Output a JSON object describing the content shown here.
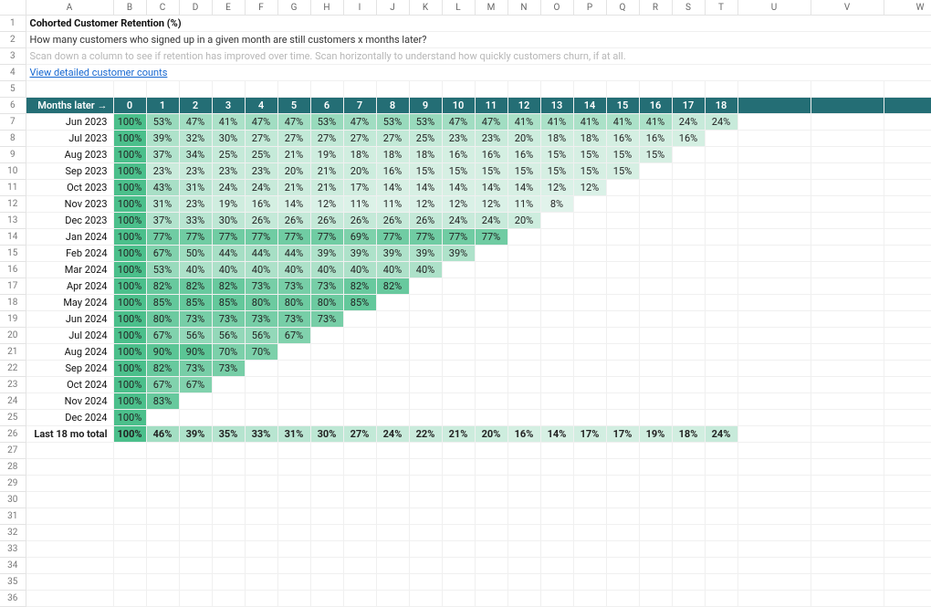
{
  "columns": [
    "A",
    "B",
    "C",
    "D",
    "E",
    "F",
    "G",
    "H",
    "I",
    "J",
    "K",
    "L",
    "M",
    "N",
    "O",
    "P",
    "Q",
    "R",
    "S",
    "T",
    "U",
    "V",
    "W"
  ],
  "row_count": 36,
  "title": "Cohorted Customer Retention (%)",
  "description": "How many customers who signed up in a given month are still customers x months later?",
  "hint": "Scan down a column to see if retention has improved over time. Scan horizontally to understand how quickly customers churn, if at all.",
  "link_text": "View detailed customer counts",
  "band_label": "Months later →",
  "months_later": [
    "0",
    "1",
    "2",
    "3",
    "4",
    "5",
    "6",
    "7",
    "8",
    "9",
    "10",
    "11",
    "12",
    "13",
    "14",
    "15",
    "16",
    "17",
    "18"
  ],
  "cohorts": [
    {
      "label": "Jun 2023",
      "values": [
        100,
        53,
        47,
        41,
        47,
        47,
        53,
        47,
        53,
        53,
        47,
        47,
        41,
        41,
        41,
        41,
        41,
        24,
        24
      ]
    },
    {
      "label": "Jul 2023",
      "values": [
        100,
        39,
        32,
        30,
        27,
        27,
        27,
        27,
        27,
        25,
        23,
        23,
        20,
        18,
        18,
        16,
        16,
        16
      ]
    },
    {
      "label": "Aug 2023",
      "values": [
        100,
        37,
        34,
        25,
        25,
        21,
        19,
        18,
        18,
        18,
        16,
        16,
        16,
        15,
        15,
        15,
        15
      ]
    },
    {
      "label": "Sep 2023",
      "values": [
        100,
        23,
        23,
        23,
        23,
        20,
        21,
        20,
        16,
        15,
        15,
        15,
        15,
        15,
        15,
        15
      ]
    },
    {
      "label": "Oct 2023",
      "values": [
        100,
        43,
        31,
        24,
        24,
        21,
        21,
        17,
        14,
        14,
        14,
        14,
        14,
        12,
        12
      ]
    },
    {
      "label": "Nov 2023",
      "values": [
        100,
        31,
        23,
        19,
        16,
        14,
        12,
        11,
        11,
        12,
        12,
        12,
        11,
        8
      ]
    },
    {
      "label": "Dec 2023",
      "values": [
        100,
        37,
        33,
        30,
        26,
        26,
        26,
        26,
        26,
        26,
        24,
        24,
        20
      ]
    },
    {
      "label": "Jan 2024",
      "values": [
        100,
        77,
        77,
        77,
        77,
        77,
        77,
        69,
        77,
        77,
        77,
        77
      ]
    },
    {
      "label": "Feb 2024",
      "values": [
        100,
        67,
        50,
        44,
        44,
        44,
        39,
        39,
        39,
        39,
        39
      ]
    },
    {
      "label": "Mar 2024",
      "values": [
        100,
        53,
        40,
        40,
        40,
        40,
        40,
        40,
        40,
        40
      ]
    },
    {
      "label": "Apr 2024",
      "values": [
        100,
        82,
        82,
        82,
        73,
        73,
        73,
        82,
        82
      ]
    },
    {
      "label": "May 2024",
      "values": [
        100,
        85,
        85,
        85,
        80,
        80,
        80,
        85
      ]
    },
    {
      "label": "Jun 2024",
      "values": [
        100,
        80,
        73,
        73,
        73,
        73,
        73
      ]
    },
    {
      "label": "Jul 2024",
      "values": [
        100,
        67,
        56,
        56,
        56,
        67
      ]
    },
    {
      "label": "Aug 2024",
      "values": [
        100,
        90,
        90,
        70,
        70
      ]
    },
    {
      "label": "Sep 2024",
      "values": [
        100,
        82,
        73,
        73
      ]
    },
    {
      "label": "Oct 2024",
      "values": [
        100,
        67,
        67
      ]
    },
    {
      "label": "Nov 2024",
      "values": [
        100,
        83
      ]
    },
    {
      "label": "Dec 2024",
      "values": [
        100
      ]
    }
  ],
  "summary": {
    "label": "Last 18 mo total",
    "values": [
      100,
      46,
      39,
      35,
      33,
      31,
      30,
      27,
      24,
      22,
      21,
      20,
      16,
      14,
      17,
      17,
      19,
      18,
      24
    ]
  },
  "chart_data": {
    "type": "table",
    "title": "Cohorted Customer Retention (%)",
    "xlabel": "Months later",
    "ylabel": "Cohort month",
    "categories": [
      "0",
      "1",
      "2",
      "3",
      "4",
      "5",
      "6",
      "7",
      "8",
      "9",
      "10",
      "11",
      "12",
      "13",
      "14",
      "15",
      "16",
      "17",
      "18"
    ],
    "row_labels": [
      "Jun 2023",
      "Jul 2023",
      "Aug 2023",
      "Sep 2023",
      "Oct 2023",
      "Nov 2023",
      "Dec 2023",
      "Jan 2024",
      "Feb 2024",
      "Mar 2024",
      "Apr 2024",
      "May 2024",
      "Jun 2024",
      "Jul 2024",
      "Aug 2024",
      "Sep 2024",
      "Oct 2024",
      "Nov 2024",
      "Dec 2024",
      "Last 18 mo total"
    ],
    "series": [
      {
        "name": "Jun 2023",
        "values": [
          100,
          53,
          47,
          41,
          47,
          47,
          53,
          47,
          53,
          53,
          47,
          47,
          41,
          41,
          41,
          41,
          41,
          24,
          24
        ]
      },
      {
        "name": "Jul 2023",
        "values": [
          100,
          39,
          32,
          30,
          27,
          27,
          27,
          27,
          27,
          25,
          23,
          23,
          20,
          18,
          18,
          16,
          16,
          16
        ]
      },
      {
        "name": "Aug 2023",
        "values": [
          100,
          37,
          34,
          25,
          25,
          21,
          19,
          18,
          18,
          18,
          16,
          16,
          16,
          15,
          15,
          15,
          15
        ]
      },
      {
        "name": "Sep 2023",
        "values": [
          100,
          23,
          23,
          23,
          23,
          20,
          21,
          20,
          16,
          15,
          15,
          15,
          15,
          15,
          15,
          15
        ]
      },
      {
        "name": "Oct 2023",
        "values": [
          100,
          43,
          31,
          24,
          24,
          21,
          21,
          17,
          14,
          14,
          14,
          14,
          14,
          12,
          12
        ]
      },
      {
        "name": "Nov 2023",
        "values": [
          100,
          31,
          23,
          19,
          16,
          14,
          12,
          11,
          11,
          12,
          12,
          12,
          11,
          8
        ]
      },
      {
        "name": "Dec 2023",
        "values": [
          100,
          37,
          33,
          30,
          26,
          26,
          26,
          26,
          26,
          26,
          24,
          24,
          20
        ]
      },
      {
        "name": "Jan 2024",
        "values": [
          100,
          77,
          77,
          77,
          77,
          77,
          77,
          69,
          77,
          77,
          77,
          77
        ]
      },
      {
        "name": "Feb 2024",
        "values": [
          100,
          67,
          50,
          44,
          44,
          44,
          39,
          39,
          39,
          39,
          39
        ]
      },
      {
        "name": "Mar 2024",
        "values": [
          100,
          53,
          40,
          40,
          40,
          40,
          40,
          40,
          40,
          40
        ]
      },
      {
        "name": "Apr 2024",
        "values": [
          100,
          82,
          82,
          82,
          73,
          73,
          73,
          82,
          82
        ]
      },
      {
        "name": "May 2024",
        "values": [
          100,
          85,
          85,
          85,
          80,
          80,
          80,
          85
        ]
      },
      {
        "name": "Jun 2024",
        "values": [
          100,
          80,
          73,
          73,
          73,
          73,
          73
        ]
      },
      {
        "name": "Jul 2024",
        "values": [
          100,
          67,
          56,
          56,
          56,
          67
        ]
      },
      {
        "name": "Aug 2024",
        "values": [
          100,
          90,
          90,
          70,
          70
        ]
      },
      {
        "name": "Sep 2024",
        "values": [
          100,
          82,
          73,
          73
        ]
      },
      {
        "name": "Oct 2024",
        "values": [
          100,
          67,
          67
        ]
      },
      {
        "name": "Nov 2024",
        "values": [
          100,
          83
        ]
      },
      {
        "name": "Dec 2024",
        "values": [
          100
        ]
      },
      {
        "name": "Last 18 mo total",
        "values": [
          100,
          46,
          39,
          35,
          33,
          31,
          30,
          27,
          24,
          22,
          21,
          20,
          16,
          14,
          17,
          17,
          19,
          18,
          24
        ]
      }
    ]
  }
}
